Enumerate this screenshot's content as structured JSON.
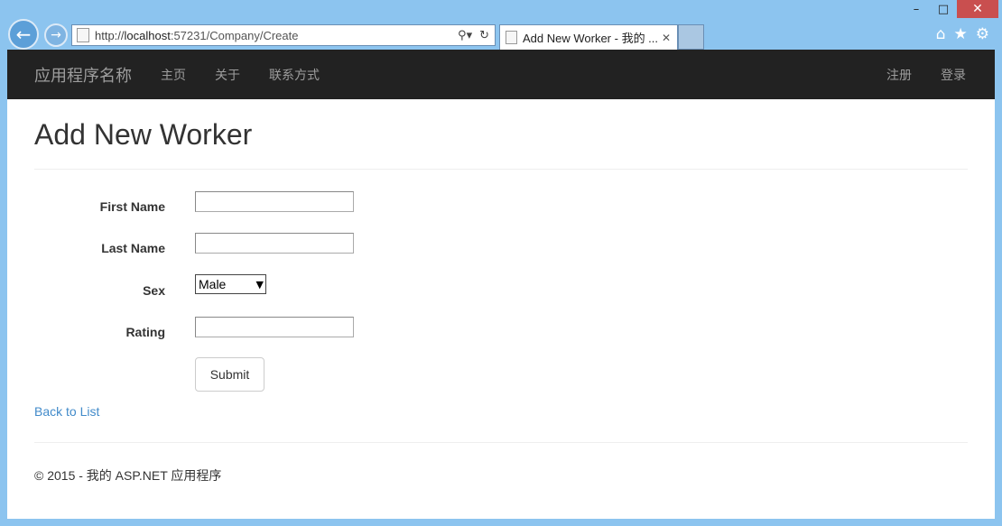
{
  "browser": {
    "url_prefix": "http://",
    "url_host": "localhost",
    "url_rest": ":57231/Company/Create",
    "tab_title": "Add New Worker - 我的 ...",
    "icons": [
      "back-arrow-icon",
      "forward-arrow-icon",
      "search-icon",
      "refresh-icon",
      "home-icon",
      "favorites-star-icon",
      "settings-gear-icon"
    ]
  },
  "navbar": {
    "brand": "应用程序名称",
    "links": [
      "主页",
      "关于",
      "联系方式"
    ],
    "right_links": [
      "注册",
      "登录"
    ]
  },
  "page": {
    "title": "Add New Worker"
  },
  "form": {
    "first_name_label": "First Name",
    "first_name_value": "",
    "last_name_label": "Last Name",
    "last_name_value": "",
    "sex_label": "Sex",
    "sex_selected": "Male",
    "rating_label": "Rating",
    "rating_value": "",
    "submit_label": "Submit"
  },
  "back_link": "Back to List",
  "footer": "© 2015 - 我的 ASP.NET 应用程序"
}
